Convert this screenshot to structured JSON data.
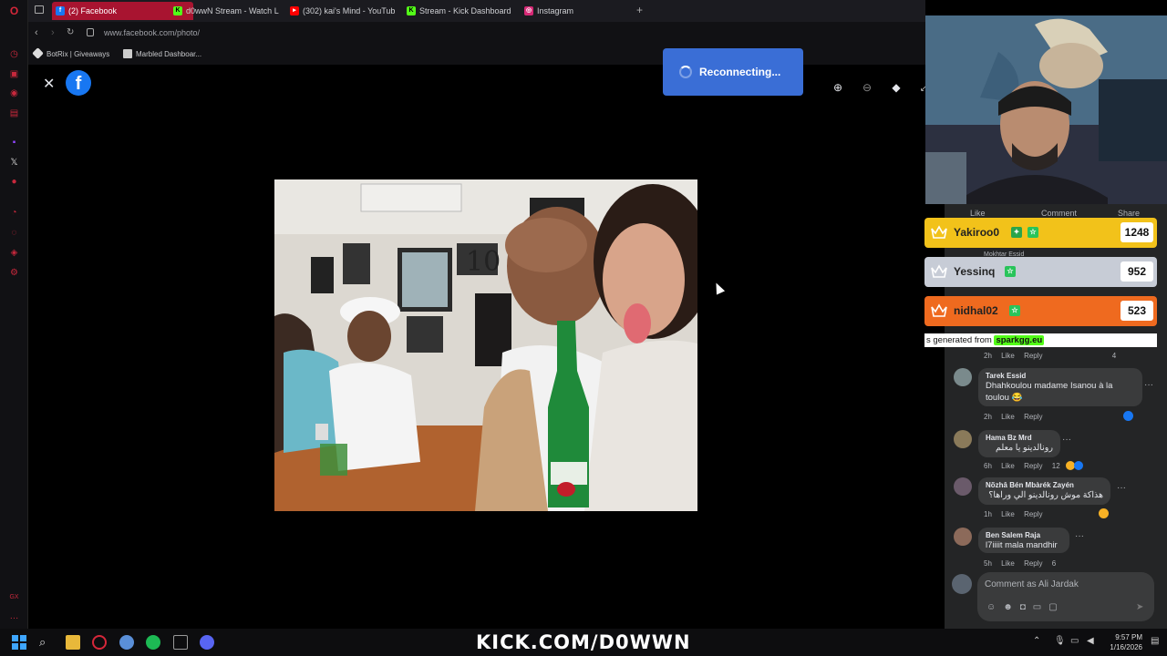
{
  "browser": {
    "tabs": [
      {
        "label": "(2) Facebook",
        "icon": "facebook-icon",
        "active": true
      },
      {
        "label": "d0wwN Stream - Watch L",
        "icon": "kick-icon"
      },
      {
        "label": "(302) kai's Mind - YouTub",
        "icon": "youtube-icon"
      },
      {
        "label": "Stream - Kick Dashboard",
        "icon": "kick-icon"
      },
      {
        "label": "Instagram",
        "icon": "instagram-icon"
      }
    ],
    "url": "www.facebook.com/photo/",
    "bookmarks": [
      {
        "label": "BotRix | Giveaways"
      },
      {
        "label": "Marbled Dashboar..."
      }
    ]
  },
  "overlay": {
    "reconnect_label": "Reconnecting..."
  },
  "post_actions": {
    "like": "Like",
    "comment": "Comment",
    "share": "Share"
  },
  "leaderboard": [
    {
      "name": "Yakiroo0",
      "score": "1248",
      "color": "#f2c21a"
    },
    {
      "name": "Yessinq",
      "score": "952",
      "color": "#c7ccd6"
    },
    {
      "name": "nidhal02",
      "score": "523",
      "color": "#ef6a1f"
    }
  ],
  "generated": {
    "prefix": "s generated from",
    "site": "sparkgg.eu"
  },
  "comments": [
    {
      "name": "Tarek Essid",
      "text_line1": "Dhahkoulou madame Isanou à la",
      "text_line2": "toulou 😂",
      "time": "2h",
      "like": "Like",
      "reply": "Reply"
    },
    {
      "name": "Hama Bz Mrd",
      "text": "رونالدينو يا معلم",
      "time": "6h",
      "like": "Like",
      "reply": "Reply",
      "reacts": "12"
    },
    {
      "name": "Nõzhâ Bén Mbàrék Zayén",
      "text": "هذاكة موش رونالدينو الي وراها؟",
      "time": "1h",
      "like": "Like",
      "reply": "Reply"
    },
    {
      "name": "Ben Salem Raja",
      "text": "l7iiiit mala mandhir",
      "time": "5h",
      "like": "Like",
      "reply": "Reply",
      "reacts": "6"
    }
  ],
  "partial_rows": [
    {
      "name": "Mokhtar Essid"
    },
    {
      "time": "2h",
      "like": "Like",
      "reply": "Reply",
      "reacts": "4"
    }
  ],
  "composer": {
    "placeholder": "Comment as Ali Jardak"
  },
  "banner": {
    "text": "KICK.COM/D0WWN"
  },
  "clock": {
    "time": "9:57 PM",
    "date": "1/16/2026"
  },
  "colors": {
    "accent": "#a81430",
    "kick_green": "#53fc18",
    "facebook_blue": "#1877f2"
  }
}
